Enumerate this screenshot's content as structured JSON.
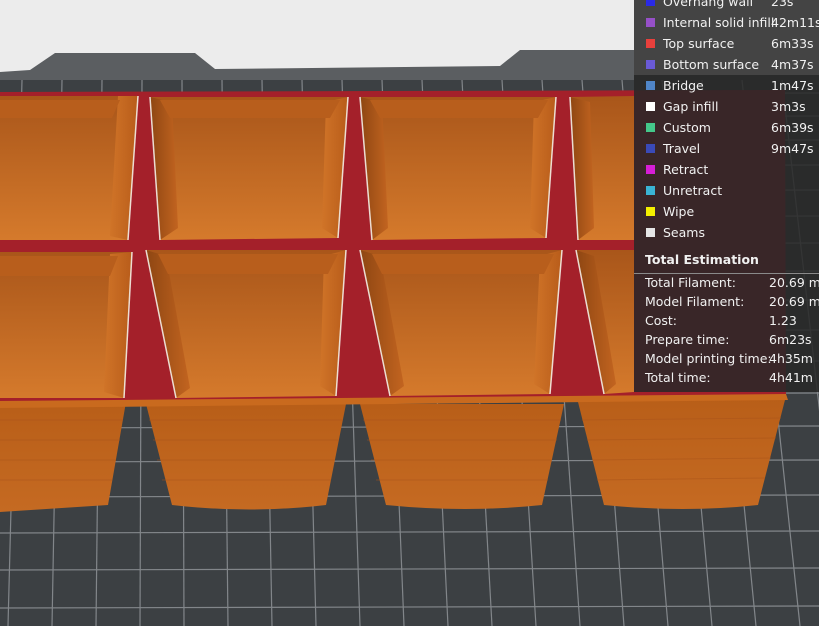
{
  "legend": {
    "items": [
      {
        "label": "Overhang wall",
        "time": "23s",
        "color": "#2a2ae6",
        "icon": "color-swatch"
      },
      {
        "label": "Internal solid infill",
        "time": "42m11s",
        "color": "#9650c8",
        "icon": "color-swatch"
      },
      {
        "label": "Top surface",
        "time": "6m33s",
        "color": "#e8403c",
        "icon": "color-swatch"
      },
      {
        "label": "Bottom surface",
        "time": "4m37s",
        "color": "#6a5ad6",
        "icon": "color-swatch"
      },
      {
        "label": "Bridge",
        "time": "1m47s",
        "color": "#4f86c8",
        "icon": "color-swatch"
      },
      {
        "label": "Gap infill",
        "time": "3m3s",
        "color": "#ffffff",
        "icon": "color-swatch"
      },
      {
        "label": "Custom",
        "time": "6m39s",
        "color": "#44c88a",
        "icon": "color-swatch"
      },
      {
        "label": "Travel",
        "time": "9m47s",
        "color": "#3a4ab8",
        "icon": "color-swatch"
      },
      {
        "label": "Retract",
        "time": "",
        "color": "#d61ed6",
        "icon": "color-swatch"
      },
      {
        "label": "Unretract",
        "time": "",
        "color": "#3ab4d4",
        "icon": "color-swatch"
      },
      {
        "label": "Wipe",
        "time": "",
        "color": "#f4f000",
        "icon": "color-swatch"
      },
      {
        "label": "Seams",
        "time": "",
        "color": "#e6e6e6",
        "icon": "color-swatch"
      }
    ]
  },
  "summary": {
    "title": "Total Estimation",
    "rows": [
      {
        "label": "Total Filament:",
        "value": "20.69 m"
      },
      {
        "label": "Model Filament:",
        "value": "20.69 m"
      },
      {
        "label": "Cost:",
        "value": "1.23"
      },
      {
        "label": "Prepare time:",
        "value": "6m23s"
      },
      {
        "label": "Model printing time:",
        "value": "4h35m"
      },
      {
        "label": "Total time:",
        "value": "4h41m"
      }
    ]
  },
  "colors": {
    "plate_background": "#3c4043",
    "grid_line": "#8f9397",
    "sky": "#ececec",
    "plate_rim": "#5a5d60",
    "model_orange": "#c96a1e",
    "model_orange_dark": "#9c4f12",
    "top_surface_red": "#a4202a"
  }
}
